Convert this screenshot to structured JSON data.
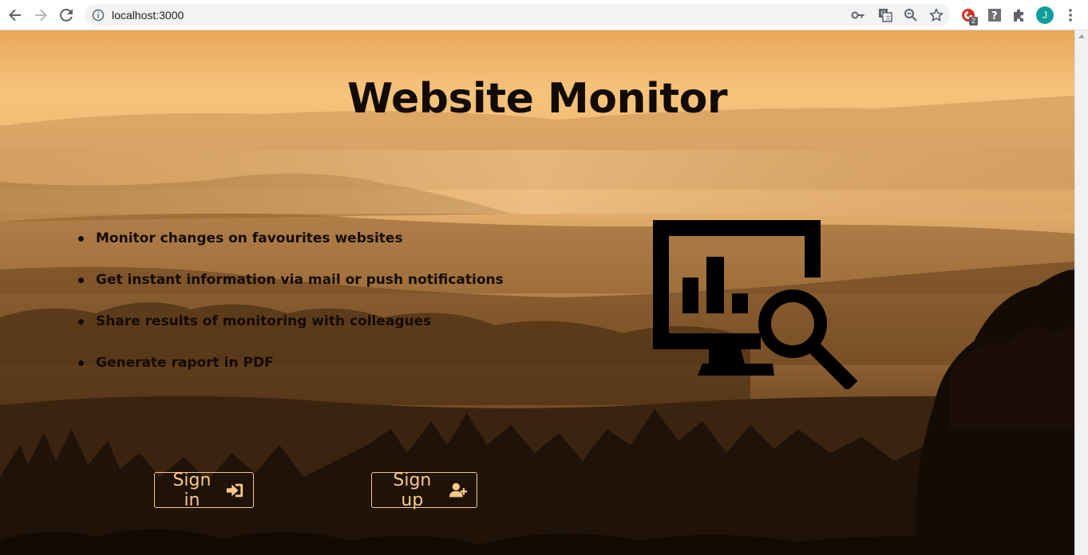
{
  "browser": {
    "url": "localhost:3000",
    "extension_badge": "2",
    "profile_initial": "J",
    "icons": [
      "back-icon",
      "forward-icon",
      "reload-icon",
      "info-icon",
      "key-icon",
      "translate-icon",
      "zoom-icon",
      "star-icon",
      "extension-icon",
      "help-icon",
      "puzzle-icon",
      "menu-icon"
    ]
  },
  "page": {
    "title": "Website Monitor",
    "features": [
      "Monitor changes on favourites websites",
      "Get instant information via mail or push notifications",
      "Share results of monitoring with colleagues",
      "Generate raport in PDF"
    ],
    "hero_icon": "monitor-analytics-search-icon",
    "sign_in_label": "Sign in",
    "sign_up_label": "Sign up"
  },
  "colors": {
    "sky": "#f6c37c",
    "title": "#120a05",
    "button_text": "#f7c98a",
    "avatar": "#0f9d9a"
  }
}
